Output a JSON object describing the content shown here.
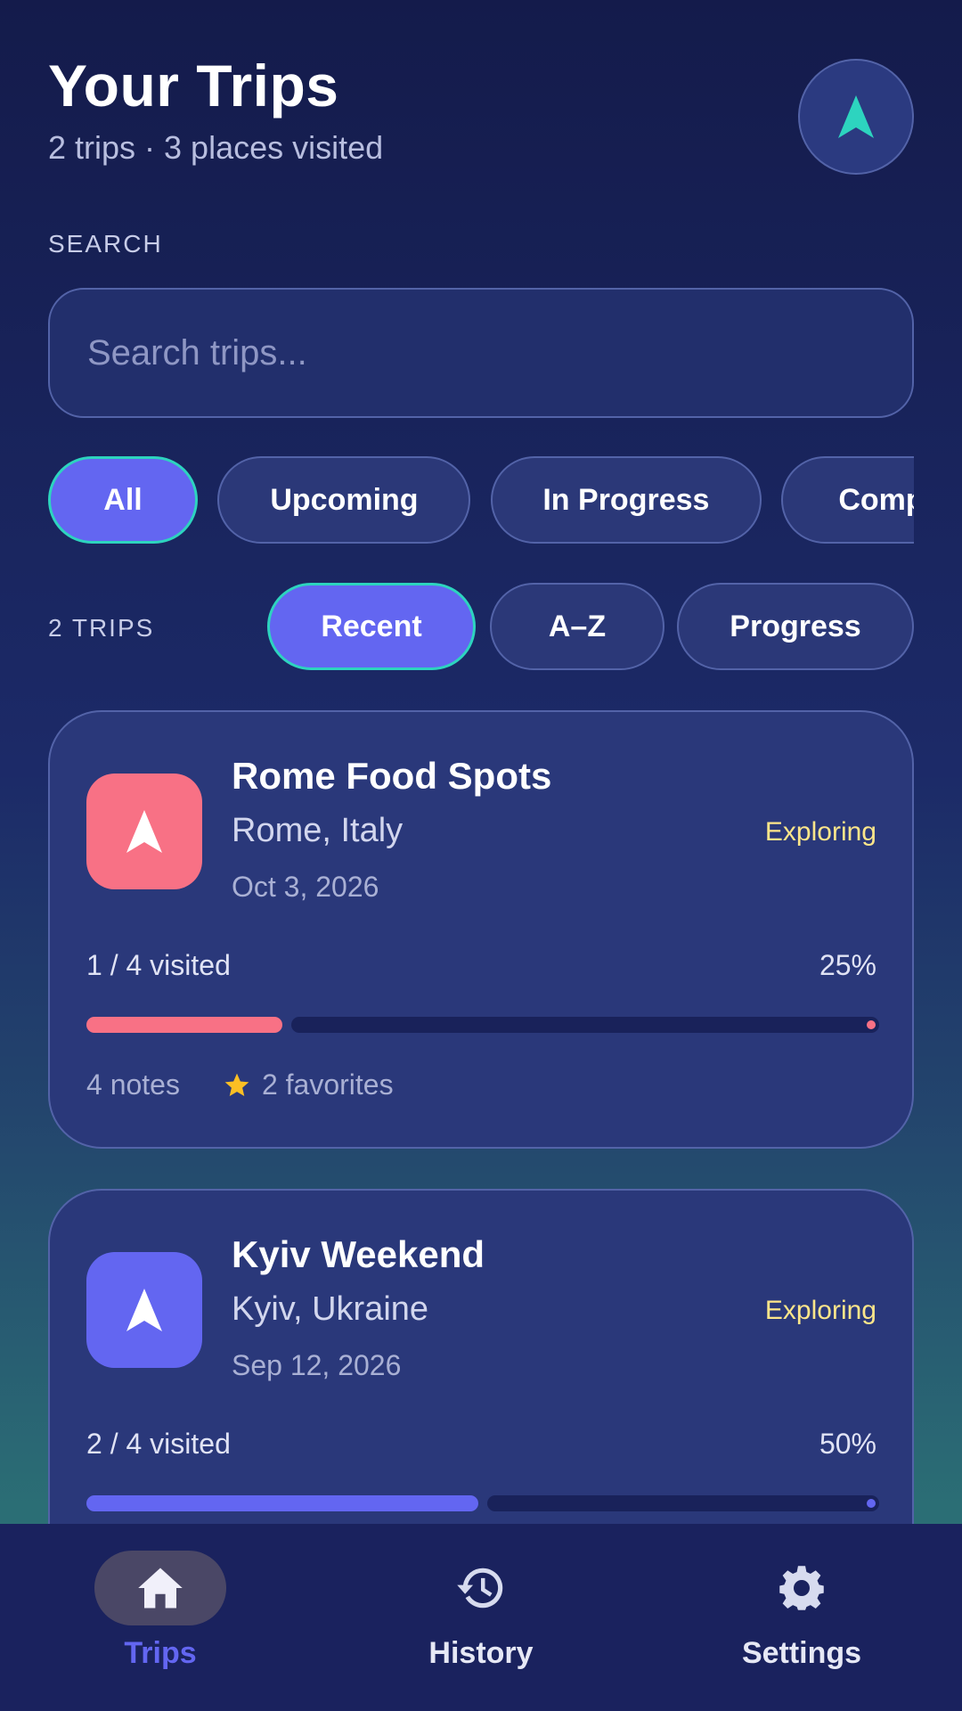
{
  "header": {
    "title": "Your Trips",
    "subtitle": "2 trips · 3 places visited"
  },
  "search": {
    "section_label": "SEARCH",
    "placeholder": "Search trips..."
  },
  "filters": [
    {
      "label": "All",
      "active": true
    },
    {
      "label": "Upcoming",
      "active": false
    },
    {
      "label": "In Progress",
      "active": false
    },
    {
      "label": "Completed",
      "active": false
    }
  ],
  "sort": {
    "count_label": "2 TRIPS",
    "options": [
      {
        "label": "Recent",
        "active": true
      },
      {
        "label": "A–Z",
        "active": false
      },
      {
        "label": "Progress",
        "active": false
      }
    ]
  },
  "trips": [
    {
      "name": "Rome Food Spots",
      "place": "Rome, Italy",
      "status": "Exploring",
      "date": "Oct 3, 2026",
      "visited": "1 / 4 visited",
      "percent_label": "25%",
      "progress": 0.25,
      "notes": "4 notes",
      "favorites": "2 favorites",
      "accent": "#f87185"
    },
    {
      "name": "Kyiv Weekend",
      "place": "Kyiv, Ukraine",
      "status": "Exploring",
      "date": "Sep 12, 2026",
      "visited": "2 / 4 visited",
      "percent_label": "50%",
      "progress": 0.5,
      "notes": "",
      "favorites": "",
      "accent": "#6366f1"
    }
  ],
  "bottom_nav": [
    {
      "label": "Trips",
      "icon": "home-icon",
      "active": true
    },
    {
      "label": "History",
      "icon": "history-icon",
      "active": false
    },
    {
      "label": "Settings",
      "icon": "settings-icon",
      "active": false
    }
  ],
  "colors": {
    "teal": "#2dd4bf",
    "indigo": "#6366f1",
    "star": "#fbbf24"
  }
}
